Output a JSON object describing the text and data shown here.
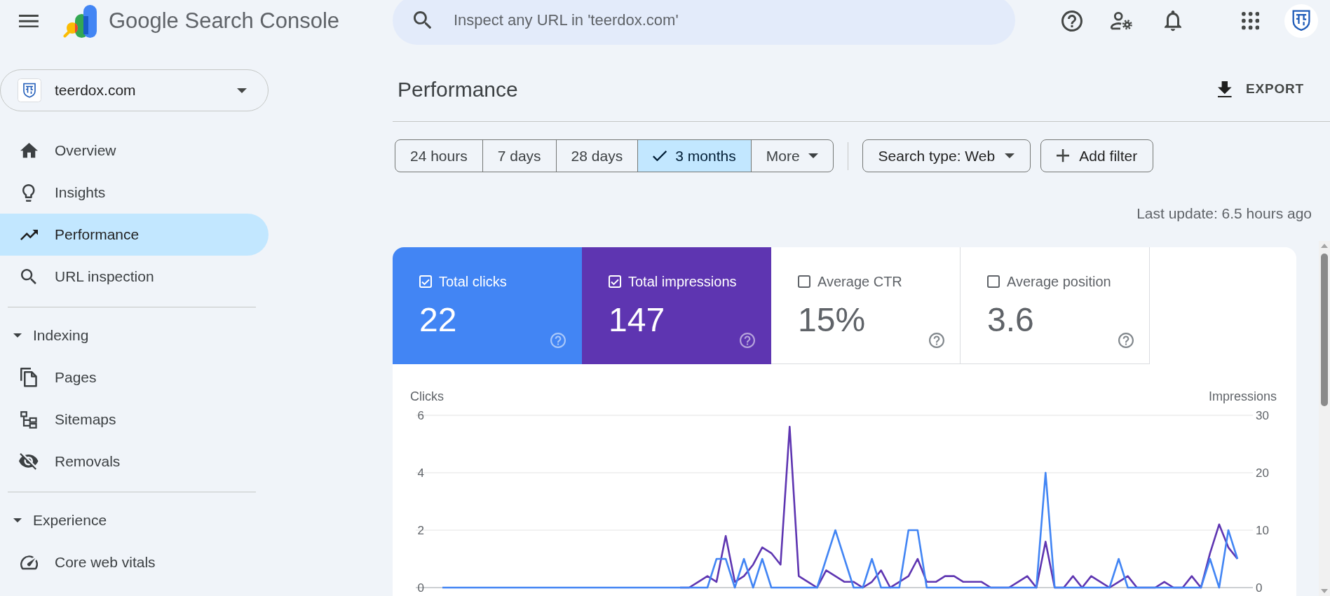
{
  "app_bar": {
    "product_name": "Google Search Console",
    "search": {
      "placeholder": "Inspect any URL in 'teerdox.com'"
    }
  },
  "sidebar": {
    "property_selector": {
      "value": "teerdox.com"
    },
    "groups": [
      {
        "items": [
          {
            "label": "Overview",
            "selected": false
          },
          {
            "label": "Insights",
            "selected": false
          },
          {
            "label": "Performance",
            "selected": true
          },
          {
            "label": "URL inspection",
            "selected": false
          }
        ]
      },
      {
        "title": "Indexing",
        "expanded": true,
        "items": [
          {
            "label": "Pages",
            "selected": false
          },
          {
            "label": "Sitemaps",
            "selected": false
          },
          {
            "label": "Removals",
            "selected": false
          }
        ]
      },
      {
        "title": "Experience",
        "expanded": true,
        "items": [
          {
            "label": "Core web vitals",
            "selected": false
          }
        ]
      }
    ]
  },
  "page": {
    "title": "Performance",
    "export": {
      "label": "EXPORT"
    }
  },
  "date_ranges": [
    {
      "kind": "option",
      "label": "24 hours",
      "selected": false
    },
    {
      "kind": "option",
      "label": "7 days",
      "selected": false
    },
    {
      "kind": "option",
      "label": "28 days",
      "selected": false
    },
    {
      "kind": "option",
      "label": "3 months",
      "selected": true
    },
    {
      "kind": "menu",
      "label": "More",
      "selected": false
    }
  ],
  "filters": [
    {
      "kind": "dropdown",
      "label": "Search type: Web"
    },
    {
      "kind": "add",
      "label": "Add filter"
    }
  ],
  "last_update": "Last update: 6.5 hours ago",
  "metrics": [
    {
      "label": "Total clicks",
      "value": "22",
      "checked": true,
      "color": "#4285f4"
    },
    {
      "label": "Total impressions",
      "value": "147",
      "checked": true,
      "color": "#5e35b1"
    },
    {
      "label": "Average CTR",
      "value": "15%",
      "checked": false
    },
    {
      "label": "Average position",
      "value": "3.6",
      "checked": false
    }
  ],
  "performance_chart": {
    "chart_data": {
      "type": "line",
      "ylabel": "Clicks",
      "y2label": "Impressions",
      "ylim": [
        0,
        6
      ],
      "yticks": [
        0,
        2,
        4,
        6
      ],
      "y2lim": [
        0,
        30
      ],
      "y2ticks": [
        0,
        10,
        20,
        30
      ],
      "series": [
        {
          "color": "#4285f4",
          "values": [
            0,
            0,
            0,
            0,
            0,
            0,
            0,
            0,
            0,
            0,
            0,
            0,
            0,
            0,
            0,
            0,
            0,
            0,
            0,
            0,
            0,
            0,
            0,
            0,
            0,
            0,
            0,
            0,
            0,
            0,
            1,
            1,
            0,
            1,
            0,
            1,
            0,
            0,
            0,
            0,
            0,
            0,
            1,
            2,
            1,
            0,
            0,
            1,
            0,
            0,
            0,
            2,
            2,
            0,
            0,
            0,
            0,
            0,
            0,
            0,
            0,
            0,
            0,
            0,
            0,
            0,
            4,
            0,
            0,
            0,
            0,
            0,
            0,
            0,
            1,
            0,
            0,
            0,
            0,
            0,
            0,
            0,
            0,
            0,
            1,
            0,
            2,
            1
          ]
        },
        {
          "color": "#5e35b1",
          "axis": "y2",
          "values": [
            null,
            null,
            null,
            null,
            null,
            null,
            null,
            null,
            null,
            null,
            null,
            null,
            null,
            null,
            null,
            null,
            null,
            null,
            null,
            null,
            null,
            null,
            null,
            null,
            null,
            null,
            0,
            0,
            1,
            2,
            1,
            9,
            1,
            2,
            4,
            7,
            6,
            4,
            28,
            2,
            1,
            0,
            3,
            2,
            1,
            1,
            0,
            1,
            3,
            0,
            1,
            2,
            5,
            1,
            1,
            2,
            2,
            1,
            1,
            1,
            0,
            0,
            0,
            1,
            2,
            0,
            8,
            0,
            0,
            2,
            0,
            2,
            1,
            0,
            1,
            2,
            0,
            0,
            0,
            1,
            0,
            0,
            2,
            0,
            6,
            11,
            7,
            5
          ]
        }
      ]
    }
  }
}
